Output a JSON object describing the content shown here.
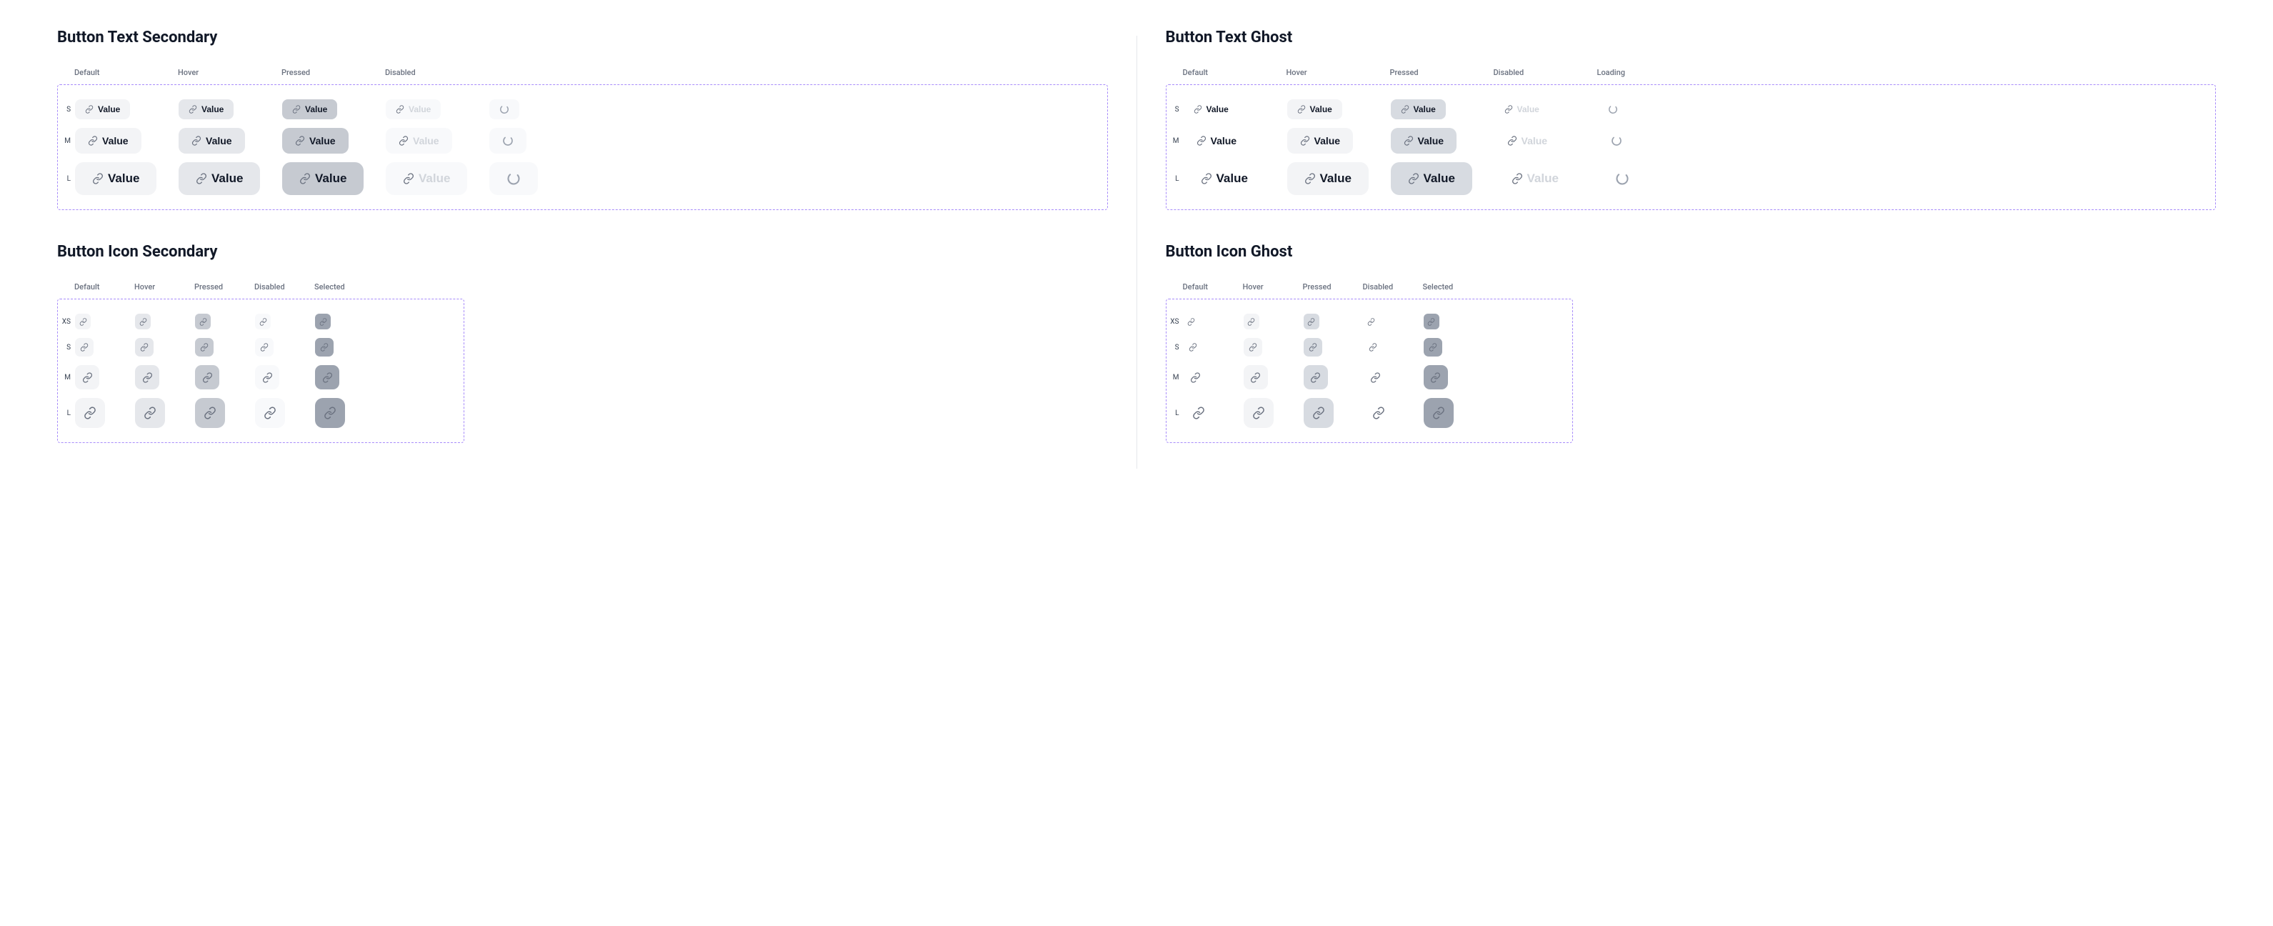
{
  "sections": {
    "text_secondary_title": "Button Text Secondary",
    "text_ghost_title": "Button Text Ghost",
    "icon_secondary_title": "Button Icon Secondary",
    "icon_ghost_title": "Button Icon Ghost"
  },
  "state_headers": {
    "default": "Default",
    "hover": "Hover",
    "pressed": "Pressed",
    "disabled": "Disabled",
    "selected": "Selected",
    "loading": "Loading"
  },
  "size_labels": {
    "xs": "XS",
    "s": "S",
    "m": "M",
    "l": "L"
  },
  "button_label": "Value",
  "icon_name": "link-icon",
  "text_secondary": {
    "states": [
      "default",
      "hover",
      "pressed",
      "disabled",
      "loading"
    ],
    "sizes": [
      "s",
      "m",
      "l"
    ]
  },
  "text_ghost": {
    "states": [
      "default",
      "hover",
      "pressed",
      "disabled",
      "loading"
    ],
    "sizes": [
      "s",
      "m",
      "l"
    ]
  },
  "icon_secondary": {
    "states": [
      "default",
      "hover",
      "pressed",
      "disabled",
      "selected"
    ],
    "sizes": [
      "xs",
      "s",
      "m",
      "l"
    ]
  },
  "icon_ghost": {
    "states": [
      "default",
      "hover",
      "pressed",
      "disabled",
      "selected"
    ],
    "sizes": [
      "xs",
      "s",
      "m",
      "l"
    ]
  }
}
